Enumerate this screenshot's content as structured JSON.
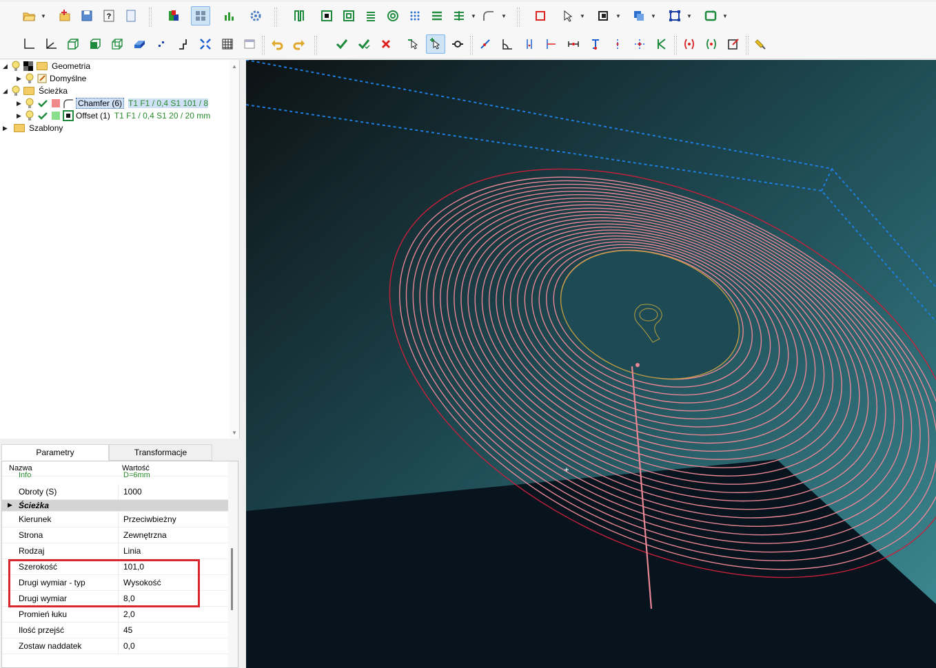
{
  "toolbar1": {
    "icons": [
      "open-icon",
      "new-icon",
      "save-icon",
      "help-icon",
      "page-icon",
      "colors-icon",
      "grid-view-icon",
      "chart-icon",
      "settings-icon",
      "pocket-icon",
      "offset-icon",
      "offset-inner-icon",
      "hatch-icon",
      "spiral-icon",
      "drill-points-icon",
      "lines-icon",
      "zigzag-icon",
      "chamfer-icon",
      "frame-icon",
      "select-icon",
      "layers-icon",
      "copy-icon",
      "transform-icon",
      "refresh-icon"
    ]
  },
  "toolbar2": {
    "icons": [
      "axis-icon",
      "axis-rotate-icon",
      "cube-front-icon",
      "cube-icon",
      "cube-wire-icon",
      "solid-icon",
      "points-icon",
      "step-icon",
      "fit-view-icon",
      "grid-icon",
      "window-icon",
      "undo-icon",
      "redo-icon",
      "check-icon",
      "check-all-icon",
      "cancel-icon",
      "pick-icon",
      "pick-move-icon",
      "node-icon",
      "snap-icon",
      "angle-icon",
      "vertical-dim-icon",
      "left-dim-icon",
      "horizontal-dim-icon",
      "top-dim-icon",
      "center-dim-icon",
      "cross-dim-icon",
      "k-dim-icon",
      "bracket-red-icon",
      "bracket-green-icon",
      "edit-icon",
      "brush-icon"
    ]
  },
  "tree": {
    "geometria": "Geometria",
    "domyslne": "Domyślne",
    "sciezka": "Ścieżka",
    "chamfer": {
      "label": "Chamfer (6)",
      "info": "T1  F1 / 0,4  S1  101 / 8",
      "color": "#f08a8a"
    },
    "offset": {
      "label": "Offset (1)",
      "info": "T1  F1 / 0,4  S1  20 / 20 mm",
      "color": "#8ae08a"
    },
    "szablony": "Szablony"
  },
  "tabs": {
    "params": "Parametry",
    "transform": "Transformacje"
  },
  "props": {
    "header": {
      "name": "Nazwa",
      "value": "Wartość"
    },
    "info_row": {
      "name": "Info",
      "value": "D=6mm"
    },
    "obroty": {
      "name": "Obroty (S)",
      "value": "1000"
    },
    "section": "Ścieżka",
    "kierunek": {
      "name": "Kierunek",
      "value": "Przeciwbieżny"
    },
    "strona": {
      "name": "Strona",
      "value": "Zewnętrzna"
    },
    "rodzaj": {
      "name": "Rodzaj",
      "value": "Linia"
    },
    "szerokosc": {
      "name": "Szerokość",
      "value": "101,0"
    },
    "drugi_typ": {
      "name": "Drugi wymiar - typ",
      "value": "Wysokość"
    },
    "drugi": {
      "name": "Drugi wymiar",
      "value": "8,0"
    },
    "promien": {
      "name": "Promień łuku",
      "value": "2,0"
    },
    "ilosc": {
      "name": "Ilość przejść",
      "value": "45"
    },
    "zostaw": {
      "name": "Zostaw naddatek",
      "value": "0,0"
    }
  },
  "viewport": {
    "ring_count": 24,
    "colors": {
      "toolpath": "#e98795",
      "boundary": "#c8203a",
      "stock": "#1e7fe0",
      "hole": "#c8a040"
    }
  }
}
